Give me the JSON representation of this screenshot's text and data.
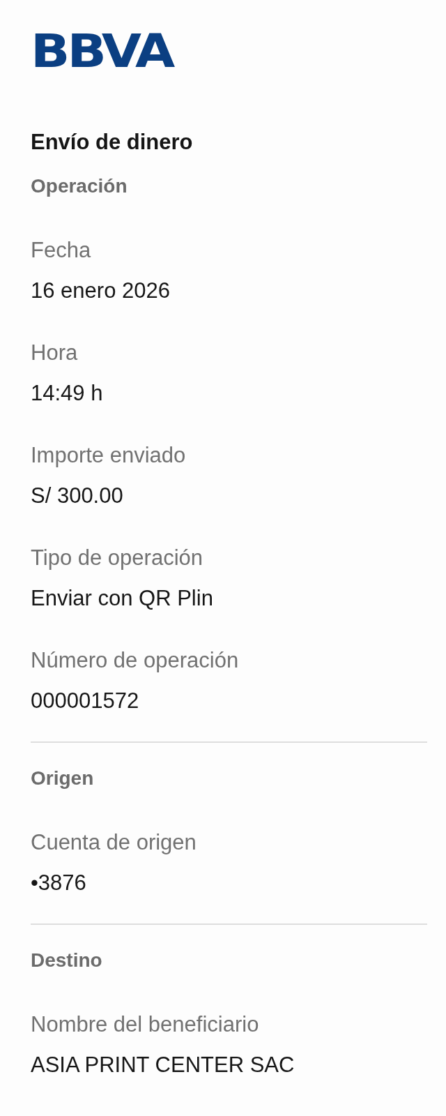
{
  "logo": "BBVA",
  "title": "Envío de dinero",
  "sections": [
    {
      "heading": "Operación",
      "fields": [
        {
          "label": "Fecha",
          "value": "16 enero 2026"
        },
        {
          "label": "Hora",
          "value": "14:49 h"
        },
        {
          "label": "Importe enviado",
          "value": "S/ 300.00"
        },
        {
          "label": "Tipo de operación",
          "value": "Enviar con QR Plin"
        },
        {
          "label": "Número de operación",
          "value": "000001572"
        }
      ]
    },
    {
      "heading": "Origen",
      "fields": [
        {
          "label": "Cuenta de origen",
          "value": "•3876"
        }
      ]
    },
    {
      "heading": "Destino",
      "fields": [
        {
          "label": "Nombre del beneficiario",
          "value": "ASIA PRINT CENTER SAC"
        }
      ]
    }
  ]
}
